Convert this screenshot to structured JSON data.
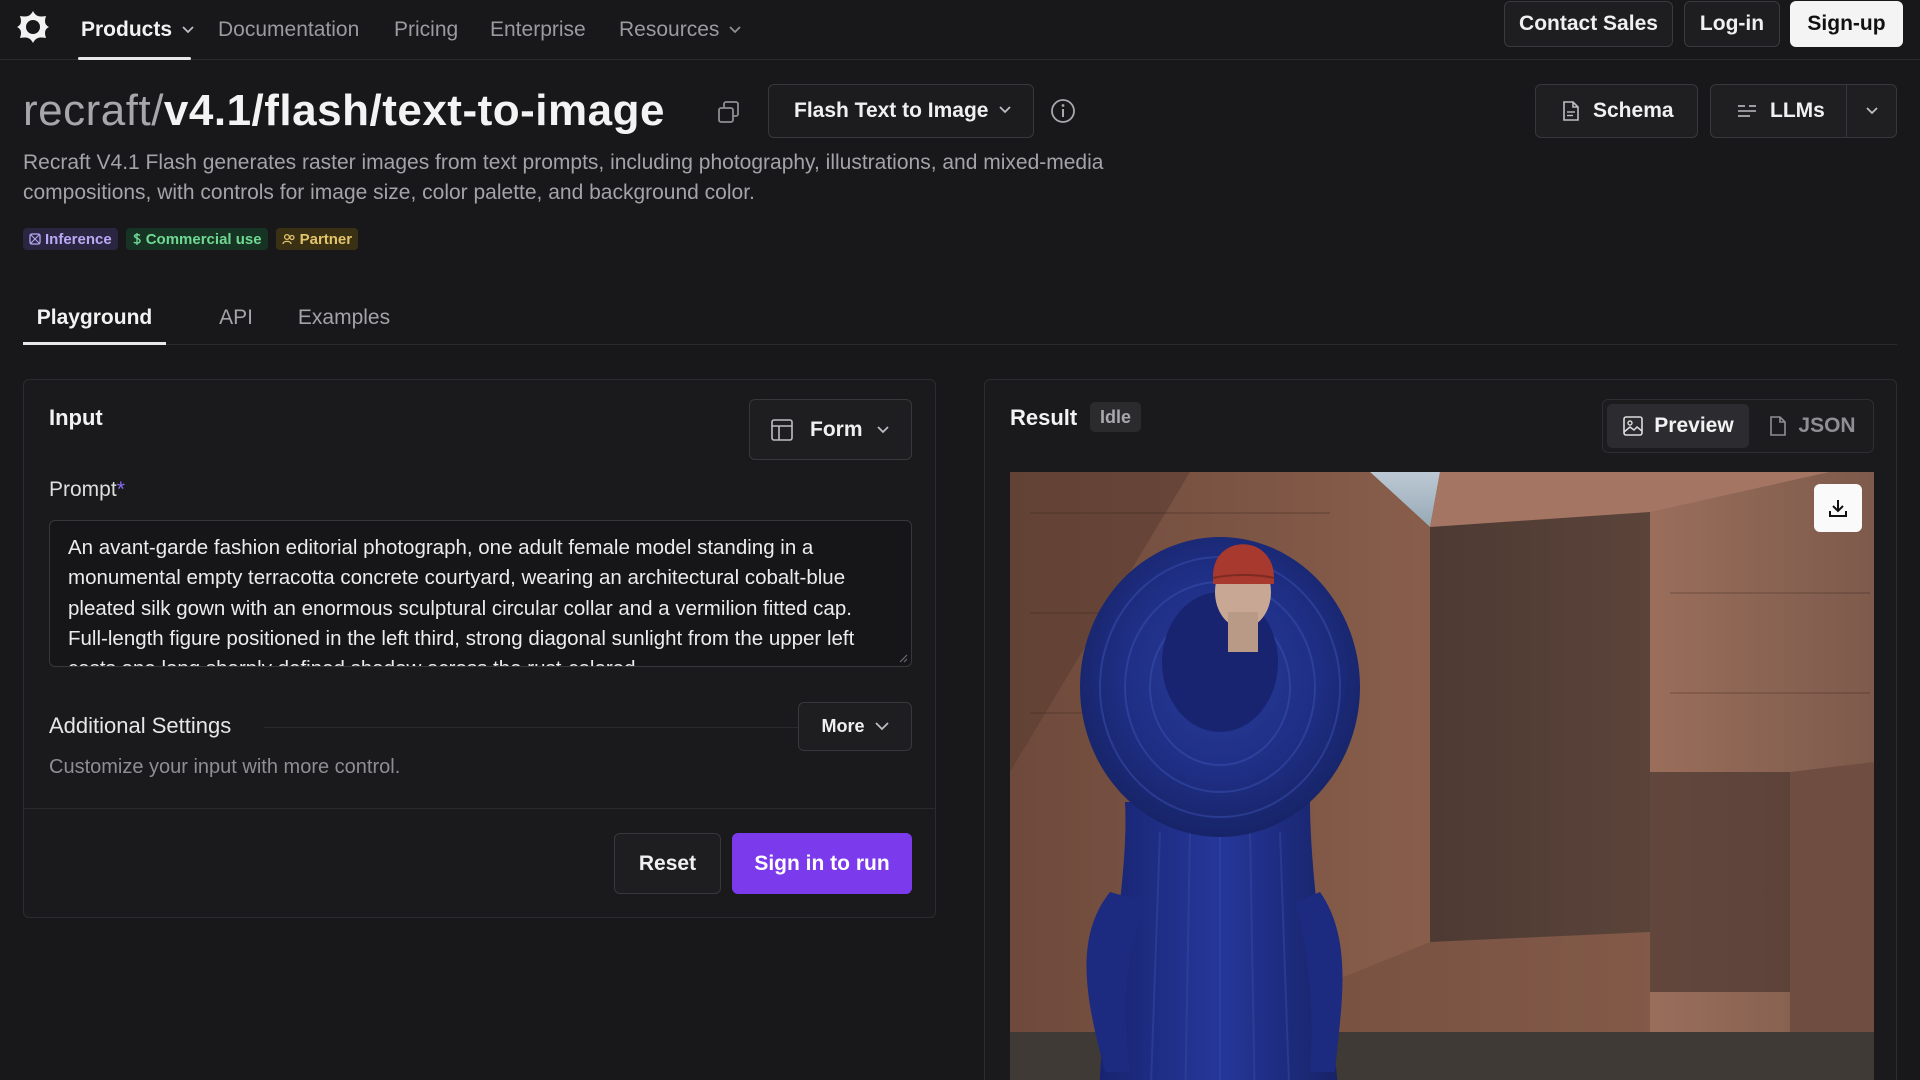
{
  "nav": {
    "items": [
      {
        "label": "Products",
        "has_dropdown": true,
        "active": true
      },
      {
        "label": "Documentation",
        "has_dropdown": false,
        "active": false
      },
      {
        "label": "Pricing",
        "has_dropdown": false,
        "active": false
      },
      {
        "label": "Enterprise",
        "has_dropdown": false,
        "active": false
      },
      {
        "label": "Resources",
        "has_dropdown": true,
        "active": false
      }
    ],
    "contact_sales_label": "Contact Sales",
    "login_label": "Log-in",
    "signup_label": "Sign-up"
  },
  "header": {
    "title_prefix": "recraft/",
    "title_name": "v4.1/flash/text-to-image",
    "variant_select_value": "Flash Text to Image",
    "schema_label": "Schema",
    "llms_label": "LLMs",
    "description": "Recraft V4.1 Flash generates raster images from text prompts, including photography, illustrations, and mixed-media compositions, with controls for image size, color palette, and background color.",
    "badges": [
      {
        "label": "Inference",
        "icon": "inference-icon"
      },
      {
        "label": "Commercial use",
        "icon": "dollar-icon"
      },
      {
        "label": "Partner",
        "icon": "partner-icon"
      }
    ]
  },
  "tabs": [
    {
      "label": "Playground",
      "active": true
    },
    {
      "label": "API",
      "active": false
    },
    {
      "label": "Examples",
      "active": false
    }
  ],
  "input_panel": {
    "title": "Input",
    "mode_label": "Form",
    "prompt_label": "Prompt",
    "prompt_required_mark": "*",
    "prompt_value": "An avant-garde fashion editorial photograph, one adult female model standing in a monumental empty terracotta concrete courtyard, wearing an architectural cobalt-blue pleated silk gown with an enormous sculptural circular collar and a vermilion fitted cap. Full-length figure positioned in the left third, strong diagonal sunlight from the upper left casts one long sharply defined shadow across the rust-colored",
    "additional_settings_title": "Additional Settings",
    "additional_settings_sub": "Customize your input with more control.",
    "more_label": "More",
    "reset_label": "Reset",
    "run_label": "Sign in to run"
  },
  "result_panel": {
    "title": "Result",
    "status": "Idle",
    "preview_label": "Preview",
    "json_label": "JSON"
  },
  "colors": {
    "accent": "#7c3aed",
    "background": "#18181a",
    "required_mark": "#8b6cf6"
  }
}
